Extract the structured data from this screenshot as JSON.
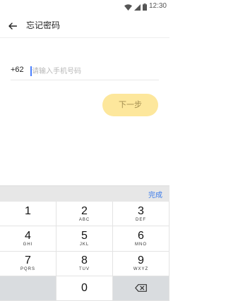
{
  "status_bar": {
    "time": "12:30",
    "icons": [
      "wifi-icon",
      "signal-icon",
      "battery-icon"
    ]
  },
  "header": {
    "back_icon": "arrow-left-icon",
    "title": "忘记密码"
  },
  "form": {
    "country_code": "+62",
    "phone_value": "",
    "phone_placeholder": "请输入手机号码",
    "next_label": "下一步"
  },
  "keyboard": {
    "done_label": "完成",
    "keys": [
      {
        "num": "1",
        "letters": ""
      },
      {
        "num": "2",
        "letters": "ABC"
      },
      {
        "num": "3",
        "letters": "DEF"
      },
      {
        "num": "4",
        "letters": "GHI"
      },
      {
        "num": "5",
        "letters": "JKL"
      },
      {
        "num": "6",
        "letters": "MNO"
      },
      {
        "num": "7",
        "letters": "PQRS"
      },
      {
        "num": "8",
        "letters": "TUV"
      },
      {
        "num": "9",
        "letters": "WXYZ"
      },
      {
        "num": "0",
        "letters": ""
      }
    ],
    "backspace_icon": "backspace-icon"
  },
  "colors": {
    "accent_blue": "#3b7bea",
    "button_yellow": "#fde79c",
    "button_text": "#a28d4f"
  }
}
